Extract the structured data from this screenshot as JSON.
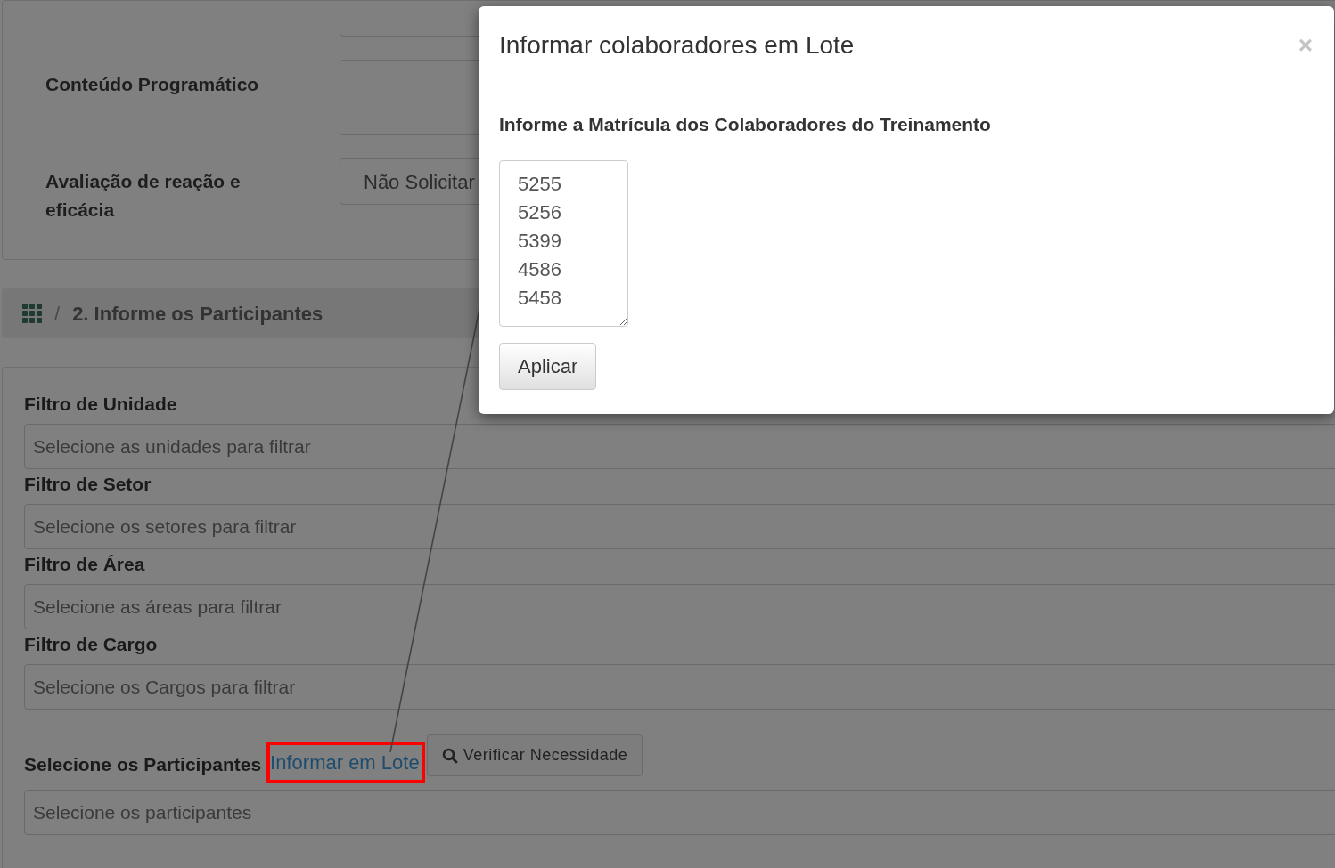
{
  "form_top": {
    "fields": [
      {
        "kind": "input"
      },
      {
        "kind": "textarea",
        "label": "Conteúdo Programático"
      },
      {
        "kind": "select",
        "label": "Avaliação de reação e eficácia",
        "value": "Não Solicitar"
      }
    ]
  },
  "section_header": {
    "title": "2. Informe os Participantes",
    "separator": "/"
  },
  "filters": [
    {
      "label": "Filtro de Unidade",
      "placeholder": "Selecione as unidades para filtrar"
    },
    {
      "label": "Filtro de Setor",
      "placeholder": "Selecione os setores para filtrar"
    },
    {
      "label": "Filtro de Área",
      "placeholder": "Selecione as áreas para filtrar"
    },
    {
      "label": "Filtro de Cargo",
      "placeholder": "Selecione os Cargos para filtrar"
    }
  ],
  "participants": {
    "label": "Selecione os Participantes",
    "link": "Informar em Lote",
    "link_highlighted": true,
    "button": "Verificar Necessidade",
    "placeholder": "Selecione os participantes"
  },
  "modal": {
    "title": "Informar colaboradores em Lote",
    "close": "×",
    "instruction": "Informe a Matrícula dos Colaboradores do Treinamento",
    "registrations": [
      "5255",
      "5256",
      "5399",
      "4586",
      "5458"
    ],
    "button": "Aplicar"
  }
}
